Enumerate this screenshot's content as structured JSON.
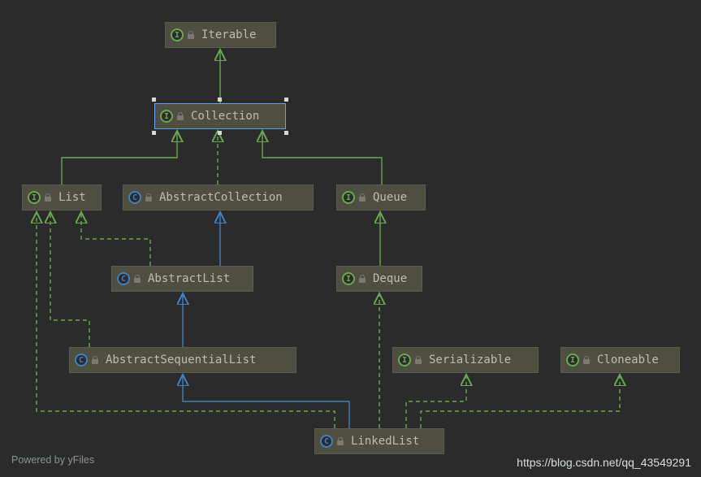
{
  "footer": {
    "watermark": "Powered by yFiles",
    "url": "https://blog.csdn.net/qq_43549291"
  },
  "nodes": {
    "iterable": {
      "label": "Iterable",
      "kind": "interface",
      "kindChar": "I"
    },
    "collection": {
      "label": "Collection",
      "kind": "interface",
      "kindChar": "I"
    },
    "list": {
      "label": "List",
      "kind": "interface",
      "kindChar": "I"
    },
    "abscoll": {
      "label": "AbstractCollection",
      "kind": "class",
      "kindChar": "C"
    },
    "queue": {
      "label": "Queue",
      "kind": "interface",
      "kindChar": "I"
    },
    "abslist": {
      "label": "AbstractList",
      "kind": "class",
      "kindChar": "C"
    },
    "deque": {
      "label": "Deque",
      "kind": "interface",
      "kindChar": "I"
    },
    "absseq": {
      "label": "AbstractSequentialList",
      "kind": "class",
      "kindChar": "C"
    },
    "serial": {
      "label": "Serializable",
      "kind": "interface",
      "kindChar": "I"
    },
    "clone": {
      "label": "Cloneable",
      "kind": "interface",
      "kindChar": "I"
    },
    "linked": {
      "label": "LinkedList",
      "kind": "class",
      "kindChar": "C"
    }
  },
  "edges": [
    {
      "from": "collection",
      "to": "iterable",
      "kind": "extends",
      "style": "solid-green"
    },
    {
      "from": "list",
      "to": "collection",
      "kind": "extends",
      "style": "solid-green"
    },
    {
      "from": "abscoll",
      "to": "collection",
      "kind": "implements",
      "style": "dashed-green"
    },
    {
      "from": "queue",
      "to": "collection",
      "kind": "extends",
      "style": "solid-green"
    },
    {
      "from": "abslist",
      "to": "abscoll",
      "kind": "extends",
      "style": "solid-blue"
    },
    {
      "from": "abslist",
      "to": "list",
      "kind": "implements",
      "style": "dashed-green"
    },
    {
      "from": "deque",
      "to": "queue",
      "kind": "extends",
      "style": "solid-green"
    },
    {
      "from": "absseq",
      "to": "abslist",
      "kind": "extends",
      "style": "solid-blue"
    },
    {
      "from": "absseq",
      "to": "list",
      "kind": "implements",
      "style": "dashed-green"
    },
    {
      "from": "linked",
      "to": "absseq",
      "kind": "extends",
      "style": "solid-blue"
    },
    {
      "from": "linked",
      "to": "list",
      "kind": "implements",
      "style": "dashed-green"
    },
    {
      "from": "linked",
      "to": "deque",
      "kind": "implements",
      "style": "dashed-green"
    },
    {
      "from": "linked",
      "to": "serial",
      "kind": "implements",
      "style": "dashed-green"
    },
    {
      "from": "linked",
      "to": "clone",
      "kind": "implements",
      "style": "dashed-green"
    }
  ]
}
